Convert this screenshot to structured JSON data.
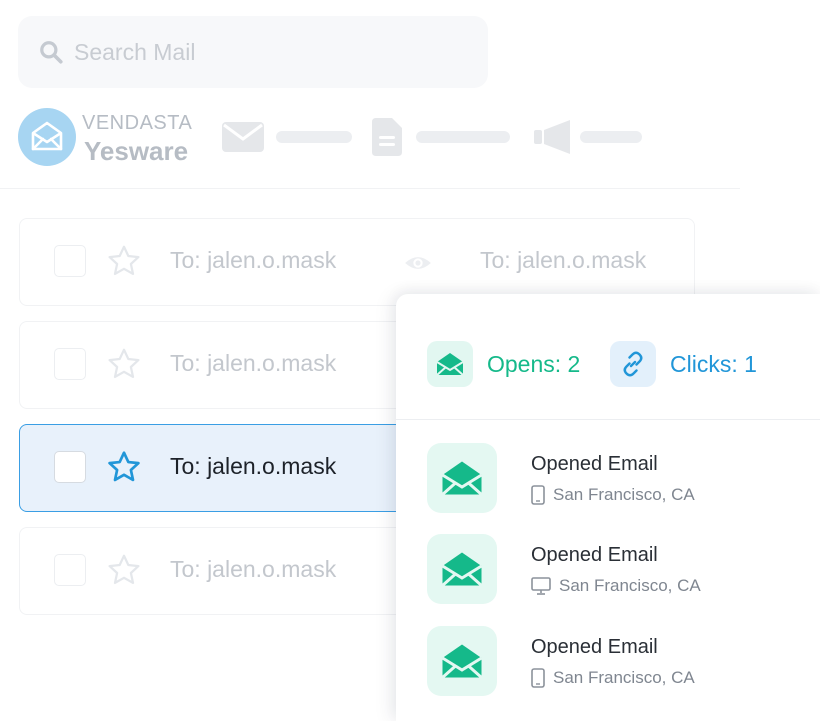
{
  "search": {
    "placeholder": "Search Mail"
  },
  "brand": {
    "company": "VENDASTA",
    "product": "Yesware"
  },
  "emails": [
    {
      "to": "To: jalen.o.mask",
      "to_secondary": "To: jalen.o.mask",
      "selected": false
    },
    {
      "to": "To: jalen.o.mask",
      "selected": false
    },
    {
      "to": "To: jalen.o.mask",
      "selected": true
    },
    {
      "to": "To: jalen.o.mask",
      "selected": false
    }
  ],
  "activity": {
    "opens_label": "Opens: 2",
    "clicks_label": "Clicks: 1",
    "events": [
      {
        "title": "Opened Email",
        "location": "San Francisco, CA",
        "device": "mobile-icon"
      },
      {
        "title": "Opened Email",
        "location": "San Francisco, CA",
        "device": "desktop-icon"
      },
      {
        "title": "Opened Email",
        "location": "San Francisco, CA",
        "device": "mobile-icon"
      }
    ]
  },
  "colors": {
    "accent_green": "#15b98a",
    "accent_blue": "#2196d8",
    "selected_border": "#3a9ee4",
    "selected_bg": "#e8f1fb"
  }
}
